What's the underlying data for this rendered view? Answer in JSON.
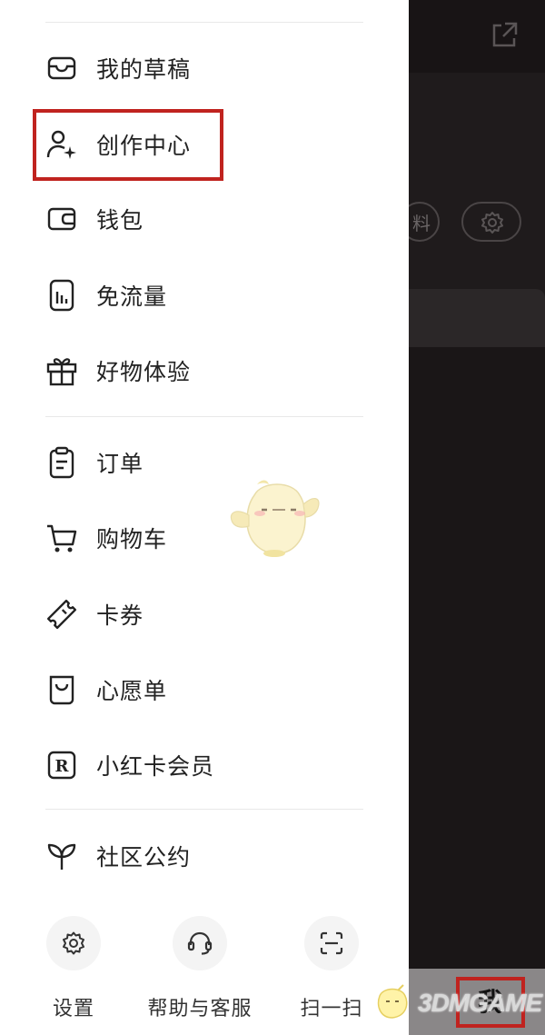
{
  "drawer": {
    "group1": [
      {
        "label": "我的草稿",
        "icon": "drafts-icon"
      },
      {
        "label": "创作中心",
        "icon": "creator-center-icon"
      },
      {
        "label": "钱包",
        "icon": "wallet-icon"
      },
      {
        "label": "免流量",
        "icon": "data-free-icon"
      },
      {
        "label": "好物体验",
        "icon": "gift-icon"
      }
    ],
    "group2": [
      {
        "label": "订单",
        "icon": "order-icon"
      },
      {
        "label": "购物车",
        "icon": "cart-icon"
      },
      {
        "label": "卡券",
        "icon": "coupon-icon"
      },
      {
        "label": "心愿单",
        "icon": "wishlist-icon"
      },
      {
        "label": "小红卡会员",
        "icon": "red-card-icon"
      }
    ],
    "group3": [
      {
        "label": "社区公约",
        "icon": "sprout-icon"
      }
    ],
    "bottom": [
      {
        "label": "设置",
        "icon": "gear-icon"
      },
      {
        "label": "帮助与客服",
        "icon": "headset-icon"
      },
      {
        "label": "扫一扫",
        "icon": "scan-icon"
      }
    ]
  },
  "background": {
    "pill_text": "料",
    "tab_me_label": "我"
  },
  "watermark": {
    "text": "3DMGAME"
  },
  "colors": {
    "highlight": "#c0231f",
    "text": "#222222"
  }
}
